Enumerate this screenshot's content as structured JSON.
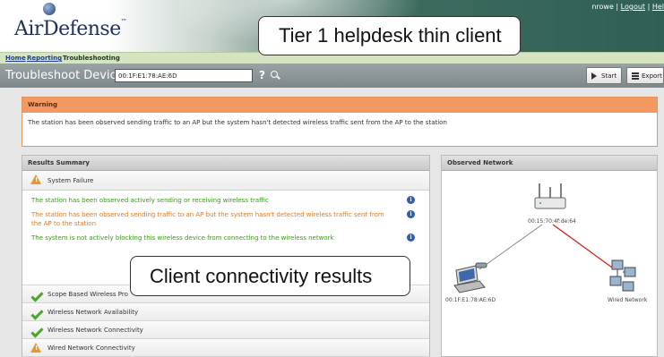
{
  "header": {
    "logo_text": "AirDefense",
    "logo_tm": "™",
    "user": "nrowe",
    "separator": " | ",
    "logout_label": "Logout",
    "help_label": "Hel"
  },
  "nav": {
    "items": [
      "Home",
      "Reporting",
      "Troubleshooting"
    ]
  },
  "toolbar": {
    "title": "Troubleshoot Device:",
    "device_value": "00:1F:E1:78:AE:6D",
    "help_label": "?",
    "start_label": "Start",
    "export_label": "Export"
  },
  "warning": {
    "title": "Warning",
    "text": "The station has been observed sending traffic to an AP but the system hasn't detected wireless traffic sent from the AP to the station"
  },
  "results": {
    "title": "Results Summary",
    "system_failure": {
      "label": "System Failure",
      "icon": "warning-icon"
    },
    "details": [
      {
        "text": "The station has been observed actively sending or receiving wireless traffic",
        "color": "#3a9a1a"
      },
      {
        "text": "The station has been observed sending traffic to an AP but the system hasn't detected wireless traffic sent from the AP to the station",
        "color": "#e07b20"
      },
      {
        "text": "The system is not actively blocking this wireless device from connecting to the wireless network",
        "color": "#3a9a1a"
      }
    ],
    "checks": [
      {
        "label": "Scope Based Wireless Pro",
        "icon": "check-icon"
      },
      {
        "label": "Wireless Network Availability",
        "icon": "check-icon"
      },
      {
        "label": "Wireless Network Connectivity",
        "icon": "check-icon"
      },
      {
        "label": "Wired Network Connectivity",
        "icon": "warning-icon"
      }
    ]
  },
  "observed": {
    "title": "Observed Network",
    "ap_label": "00:15:70:4f:de:64",
    "client_label": "00:1F:E1:78:AE:6D",
    "wired_label": "Wired Network"
  },
  "callouts": {
    "top": "Tier 1 helpdesk thin client",
    "bottom": "Client connectivity results"
  },
  "colors": {
    "warning_header": "#f29a62",
    "nav_bg": "#d6e4c2",
    "ok_green": "#3a9a1a",
    "warn_orange": "#e07b20",
    "fail_line": "#e02020"
  }
}
